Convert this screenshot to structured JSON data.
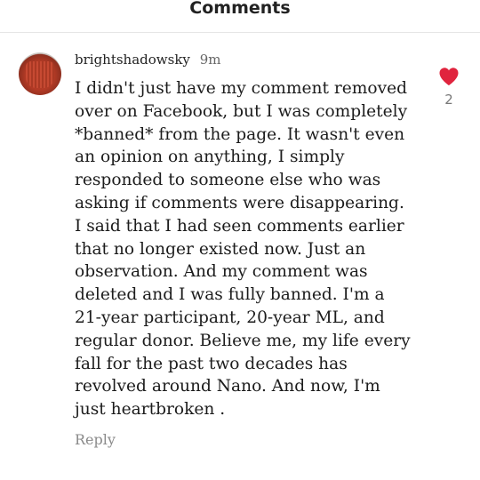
{
  "header": {
    "title": "Comments"
  },
  "comment": {
    "username": "brightshadowsky",
    "time": "9m",
    "body_lines": [
      "I didn't just have my comment removed",
      "over on Facebook, but I was completely",
      "*banned* from the page. It wasn't even",
      "an opinion on anything, I simply",
      "responded to someone else who was",
      "asking if comments were disappearing.",
      "I said that I had seen comments earlier",
      "that no longer existed now. Just an",
      "observation. And my comment was",
      "deleted and I was fully banned. I'm a",
      "21-year participant, 20-year ML, and",
      "regular donor. Believe me, my life every",
      "fall for the past two decades has",
      "revolved around Nano. And now, I'm",
      "just heartbroken ."
    ],
    "reply_label": "Reply",
    "like_count": "2",
    "like_icon": "heart-icon",
    "like_color": "#e0243e"
  }
}
